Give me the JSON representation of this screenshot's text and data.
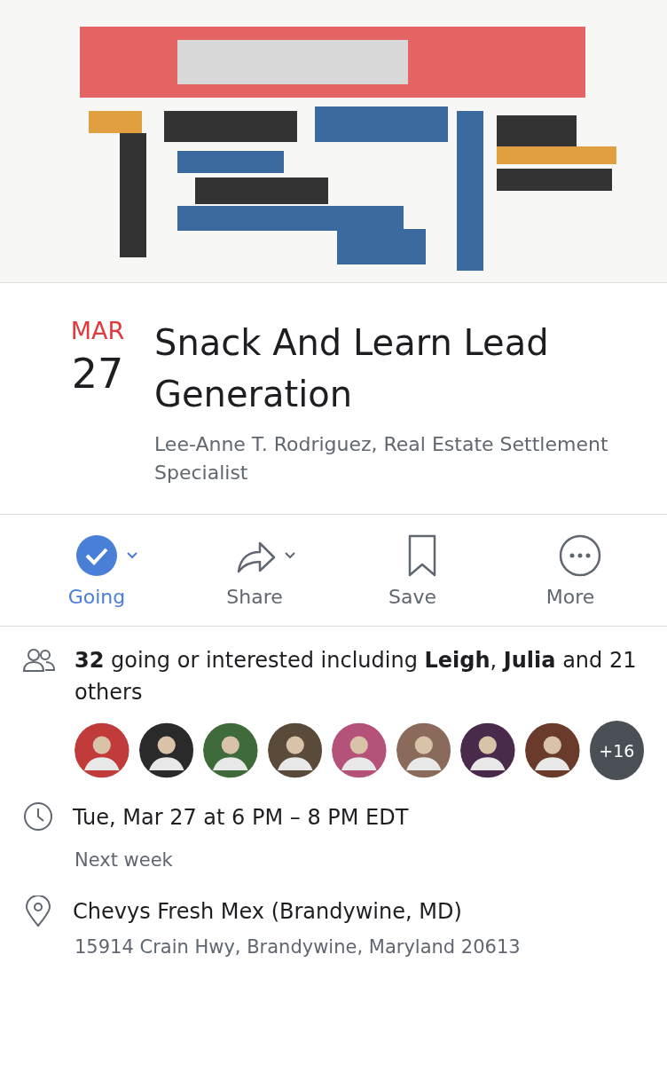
{
  "event": {
    "month": "MAR",
    "day": "27",
    "title": "Snack And Learn Lead Generation",
    "host": "Lee-Anne T. Rodriguez, Real Estate Settlement Specialist"
  },
  "actions": [
    {
      "kind": "going",
      "label": "Going",
      "selected": true,
      "dropdown": true
    },
    {
      "kind": "share",
      "label": "Share",
      "selected": false,
      "dropdown": true
    },
    {
      "kind": "save",
      "label": "Save",
      "selected": false,
      "dropdown": false
    },
    {
      "kind": "more",
      "label": "More",
      "selected": false,
      "dropdown": false
    }
  ],
  "guests": {
    "summary": "**32** going or interested including **Leigh**, **Julia** and 21 others",
    "more_count": "+16"
  },
  "time": {
    "text": "Tue, Mar 27 at 6 PM – 8 PM EDT",
    "relative": "Next week"
  },
  "place": {
    "name": "Chevys Fresh Mex (Brandywine, MD)",
    "address": "15914 Crain Hwy, Brandywine, Maryland 20613"
  }
}
